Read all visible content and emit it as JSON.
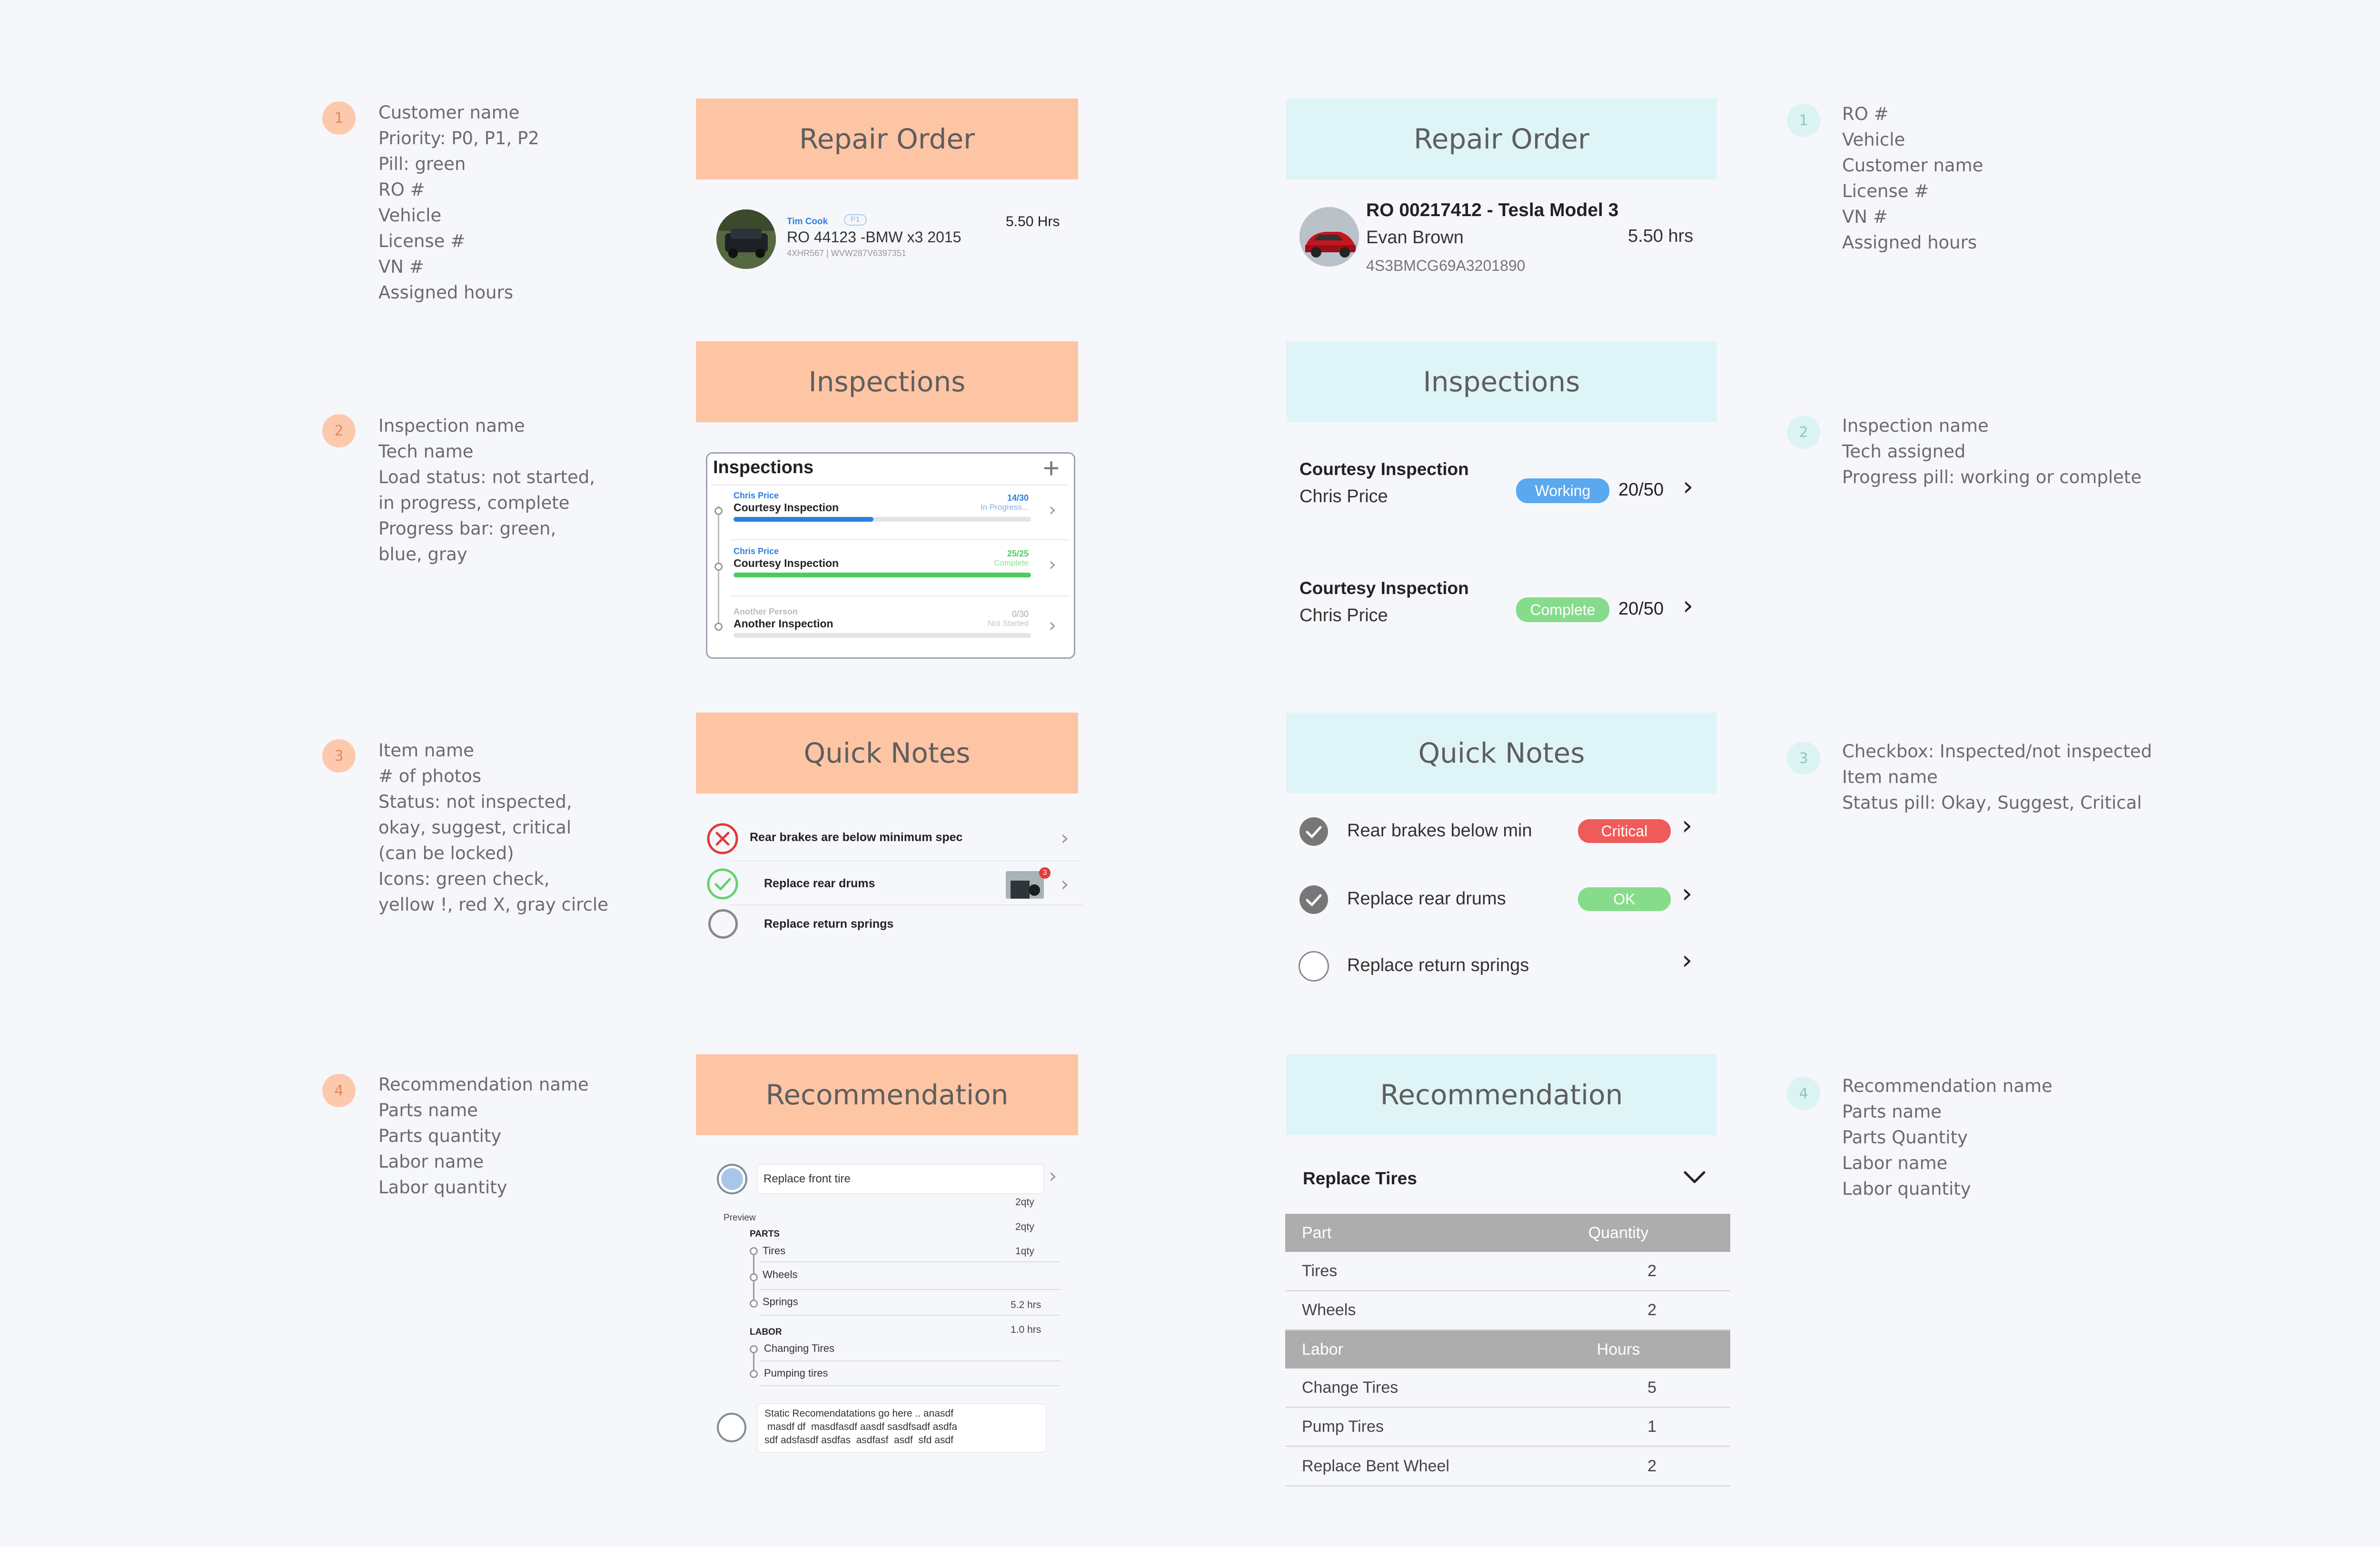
{
  "left_annotations": [
    {
      "num": "1",
      "lines": [
        "Customer name",
        "Priority: P0, P1, P2",
        "Pill: green",
        "RO #",
        "Vehicle",
        "License #",
        "VN #",
        "Assigned hours"
      ]
    },
    {
      "num": "2",
      "lines": [
        "Inspection name",
        "Tech name",
        "Load status: not started,",
        "in progress, complete",
        "Progress bar: green,",
        "blue, gray"
      ]
    },
    {
      "num": "3",
      "lines": [
        "Item name",
        "# of photos",
        "Status: not inspected,",
        "okay, suggest, critical",
        "(can be locked)",
        "Icons: green check,",
        "yellow !, red X, gray circle"
      ]
    },
    {
      "num": "4",
      "lines": [
        "Recommendation name",
        "Parts name",
        "Parts quantity",
        "Labor name",
        "Labor quantity"
      ]
    }
  ],
  "right_annotations": [
    {
      "num": "1",
      "lines": [
        "RO #",
        "Vehicle",
        "Customer name",
        "License #",
        "VN #",
        "Assigned hours"
      ]
    },
    {
      "num": "2",
      "lines": [
        "Inspection name",
        "Tech assigned",
        "Progress pill: working or complete"
      ]
    },
    {
      "num": "3",
      "lines": [
        "Checkbox: Inspected/not inspected",
        "Item name",
        "Status pill: Okay, Suggest, Critical"
      ]
    },
    {
      "num": "4",
      "lines": [
        "Recommendation name",
        "Parts name",
        "Parts Quantity",
        "Labor name",
        "Labor quantity"
      ]
    }
  ],
  "headers": {
    "repair_order": "Repair Order",
    "inspections": "Inspections",
    "quick_notes": "Quick Notes",
    "recommendation": "Recommendation"
  },
  "left": {
    "ro": {
      "customer": "Tim Cook",
      "priority": "P1",
      "ro_vehicle": "RO 44123 -BMW x3 2015",
      "license_vin": "4XHR567  |  WVW287V6397351",
      "hours": "5.50 Hrs"
    },
    "inspections": {
      "title": "Inspections",
      "add_icon": "+",
      "items": [
        {
          "tech": "Chris Price",
          "name": "Courtesy Inspection",
          "count": "14/30",
          "status": "In Progress...",
          "progress": 0.47,
          "color": "#2d7fe0"
        },
        {
          "tech": "Chris Price",
          "name": "Courtesy Inspection",
          "count": "25/25",
          "status": "Complete",
          "progress": 1.0,
          "color": "#4ccc5a"
        },
        {
          "tech": "Another Person",
          "name": "Another Inspection",
          "count": "0/30",
          "status": "Not Started",
          "progress": 0.0,
          "color": "#bdbdbd"
        }
      ]
    },
    "notes": [
      {
        "icon": "red-x",
        "name": "Rear brakes are below minimum spec"
      },
      {
        "icon": "green-check",
        "name": "Replace rear drums",
        "photo_badge": "3"
      },
      {
        "icon": "gray-circle",
        "name": "Replace return springs"
      }
    ],
    "recommendation": {
      "name": "Replace front tire",
      "preview_label": "Preview",
      "parts_label": "PARTS",
      "parts": [
        {
          "name": "Tires",
          "qty": "1qty"
        },
        {
          "name": "Wheels",
          "qty": ""
        },
        {
          "name": "Springs",
          "qty": "5.2 hrs"
        }
      ],
      "extra_qty": [
        "2qty",
        "2qty"
      ],
      "labor_label": "LABOR",
      "labor_hours": "1.0 hrs",
      "labor": [
        "Changing Tires",
        "Pumping tires"
      ],
      "static_text_1": "Static Recomendatations go here .. anasdf",
      "static_text_2": " masdf df  masdfasdf aasdf sasdfsadf asdfa",
      "static_text_3": "sdf adsfasdf asdfas  asdfasf  asdf  sfd asdf"
    }
  },
  "right": {
    "ro": {
      "title": "RO 00217412 - Tesla Model 3",
      "customer": "Evan Brown",
      "hours": "5.50 hrs",
      "vin": "4S3BMCG69A3201890"
    },
    "inspections": [
      {
        "name": "Courtesy Inspection",
        "tech": "Chris Price",
        "pill": "Working",
        "pill_color": "#5aa9ee",
        "count": "20/50"
      },
      {
        "name": "Courtesy Inspection",
        "tech": "Chris Price",
        "pill": "Complete",
        "pill_color": "#86dc8b",
        "count": "20/50"
      }
    ],
    "notes": [
      {
        "checked": true,
        "name": "Rear brakes below min",
        "pill": "Critical",
        "pill_color": "#ee5b58"
      },
      {
        "checked": true,
        "name": "Replace rear drums",
        "pill": "OK",
        "pill_color": "#86dc8b"
      },
      {
        "checked": false,
        "name": "Replace return springs",
        "pill": "",
        "pill_color": ""
      }
    ],
    "recommendation": {
      "name": "Replace Tires",
      "parts_header": [
        "Part",
        "Quantity"
      ],
      "parts": [
        [
          "Tires",
          "2"
        ],
        [
          "Wheels",
          "2"
        ]
      ],
      "labor_header": [
        "Labor",
        "Hours"
      ],
      "labor": [
        [
          "Change Tires",
          "5"
        ],
        [
          "Pump Tires",
          "1"
        ],
        [
          "Replace Bent Wheel",
          "2"
        ]
      ]
    }
  },
  "colors": {
    "orange": "#fec5a5",
    "teal": "#dff4f6",
    "blue": "#2d7fe0",
    "green": "#4ccc5a",
    "red": "#e53935"
  }
}
